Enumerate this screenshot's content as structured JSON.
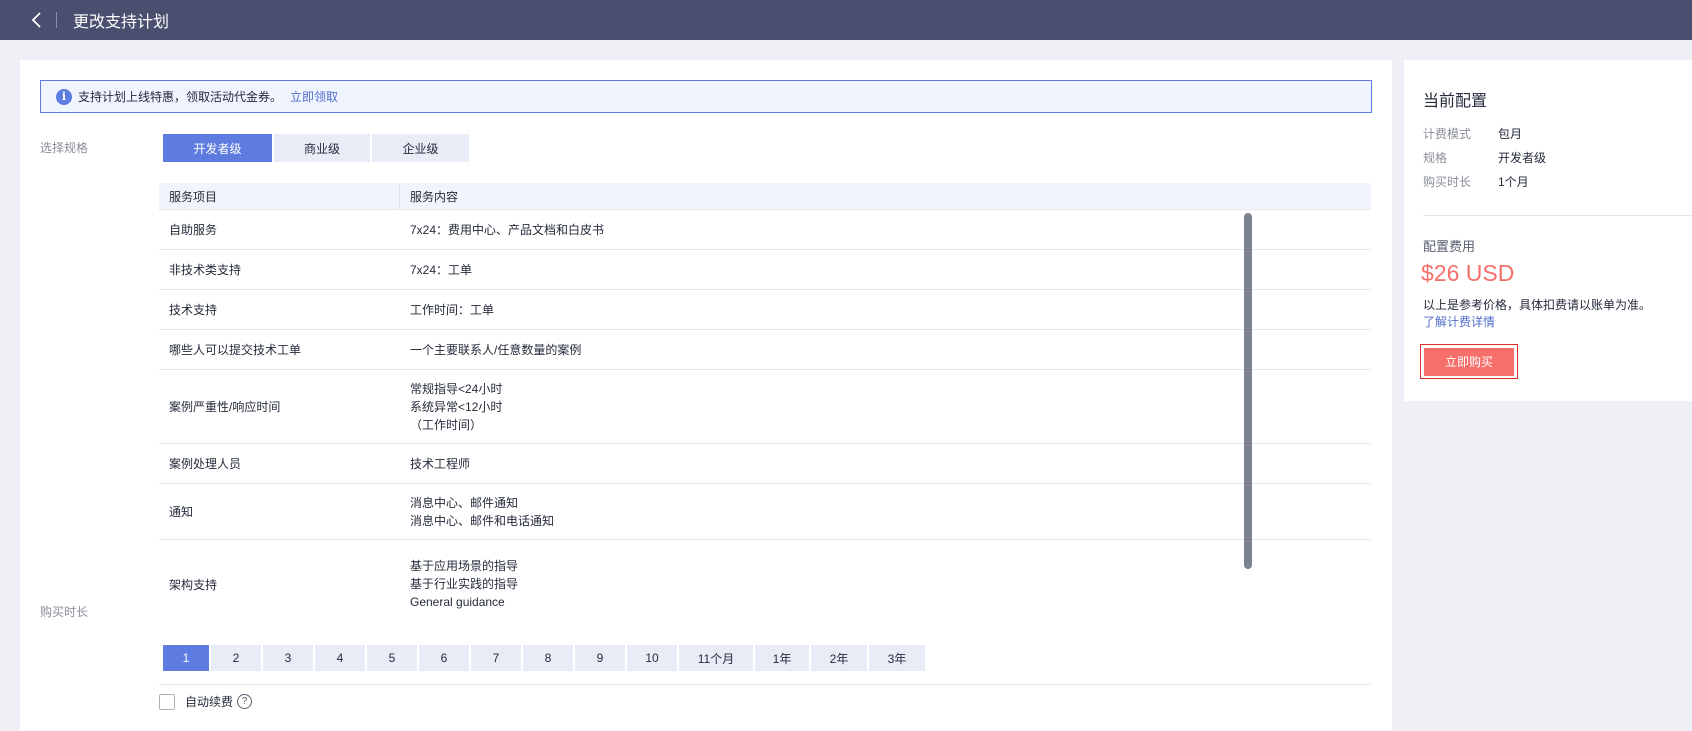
{
  "header": {
    "title": "更改支持计划",
    "back_icon": "chevron-left-icon"
  },
  "notice": {
    "text": "支持计划上线特惠，领取活动代金券。",
    "link": "立即领取",
    "icon": "info-icon"
  },
  "spec": {
    "label": "选择规格",
    "options": [
      "开发者级",
      "商业级",
      "企业级"
    ],
    "selected": "开发者级"
  },
  "table": {
    "headers": [
      "服务项目",
      "服务内容"
    ],
    "rows": [
      {
        "item": "自助服务",
        "content": [
          "7x24：费用中心、产品文档和白皮书"
        ]
      },
      {
        "item": "非技术类支持",
        "content": [
          "7x24：工单"
        ]
      },
      {
        "item": "技术支持",
        "content": [
          "工作时间：工单"
        ]
      },
      {
        "item": "哪些人可以提交技术工单",
        "content": [
          "一个主要联系人/任意数量的案例"
        ]
      },
      {
        "item": "案例严重性/响应时间",
        "content": [
          "常规指导<24小时",
          "系统异常<12小时",
          "（工作时间）"
        ]
      },
      {
        "item": "案例处理人员",
        "content": [
          "技术工程师"
        ]
      },
      {
        "item": "通知",
        "content": [
          "消息中心、邮件通知",
          "消息中心、邮件和电话通知"
        ]
      },
      {
        "item": "架构支持",
        "content": [
          "基于应用场景的指导",
          "基于行业实践的指导",
          "General guidance"
        ]
      }
    ]
  },
  "duration": {
    "label": "购买时长",
    "options": [
      "1",
      "2",
      "3",
      "4",
      "5",
      "6",
      "7",
      "8",
      "9",
      "10",
      "11个月",
      "1年",
      "2年",
      "3年"
    ],
    "selected": "1"
  },
  "auto_renew": {
    "label": "自动续费",
    "checked": false,
    "help": "?"
  },
  "summary": {
    "title": "当前配置",
    "items": [
      {
        "key": "计费模式",
        "value": "包月"
      },
      {
        "key": "规格",
        "value": "开发者级"
      },
      {
        "key": "购买时长",
        "value": "1个月"
      }
    ],
    "fee_label": "配置费用",
    "price": "$26 USD",
    "note": "以上是参考价格，具体扣费请以账单为准。",
    "link": "了解计费详情",
    "buy": "立即购买"
  },
  "colors": {
    "accent": "#5e7ce0",
    "header_bg": "#4b4f6f",
    "price": "#f66f6a",
    "link": "#526ecc"
  }
}
